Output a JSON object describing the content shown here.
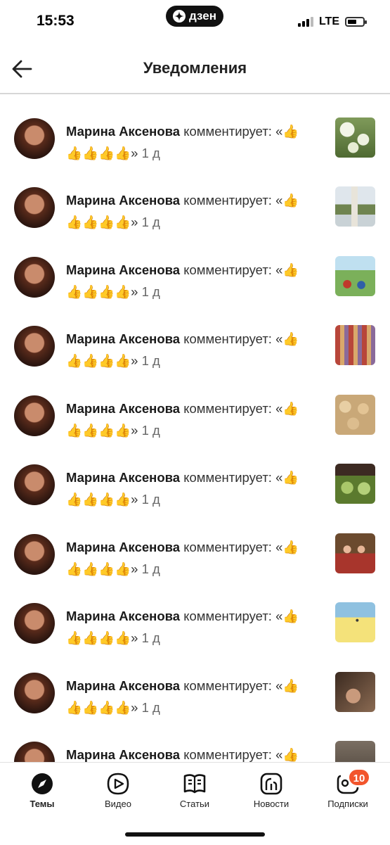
{
  "status": {
    "time": "15:53",
    "brand": "дзен",
    "network": "LTE"
  },
  "header": {
    "title": "Уведомления"
  },
  "notifications": [
    {
      "author": "Марина Аксенова",
      "action": "комментирует: «👍",
      "line2": "👍👍👍👍» ",
      "age": "1 д"
    },
    {
      "author": "Марина Аксенова",
      "action": "комментирует: «👍",
      "line2": "👍👍👍👍» ",
      "age": "1 д"
    },
    {
      "author": "Марина Аксенова",
      "action": "комментирует: «👍",
      "line2": "👍👍👍👍» ",
      "age": "1 д"
    },
    {
      "author": "Марина Аксенова",
      "action": "комментирует: «👍",
      "line2": "👍👍👍👍» ",
      "age": "1 д"
    },
    {
      "author": "Марина Аксенова",
      "action": "комментирует: «👍",
      "line2": "👍👍👍👍» ",
      "age": "1 д"
    },
    {
      "author": "Марина Аксенова",
      "action": "комментирует: «👍",
      "line2": "👍👍👍👍» ",
      "age": "1 д"
    },
    {
      "author": "Марина Аксенова",
      "action": "комментирует: «👍",
      "line2": "👍👍👍👍» ",
      "age": "1 д"
    },
    {
      "author": "Марина Аксенова",
      "action": "комментирует: «👍",
      "line2": "👍👍👍👍» ",
      "age": "1 д"
    },
    {
      "author": "Марина Аксенова",
      "action": "комментирует: «👍",
      "line2": "👍👍👍👍» ",
      "age": "1 д"
    },
    {
      "author": "Марина Аксенова",
      "action": "комментирует: «👍",
      "line2": "",
      "age": ""
    }
  ],
  "tabs": [
    {
      "label": "Темы",
      "icon": "compass-icon",
      "active": true
    },
    {
      "label": "Видео",
      "icon": "video-icon"
    },
    {
      "label": "Статьи",
      "icon": "book-icon"
    },
    {
      "label": "Новости",
      "icon": "news-icon"
    },
    {
      "label": "Подписки",
      "icon": "subscriptions-icon",
      "badge": "10"
    }
  ],
  "colors": {
    "accent": "#f2552c",
    "divider": "#d6d6d6"
  }
}
